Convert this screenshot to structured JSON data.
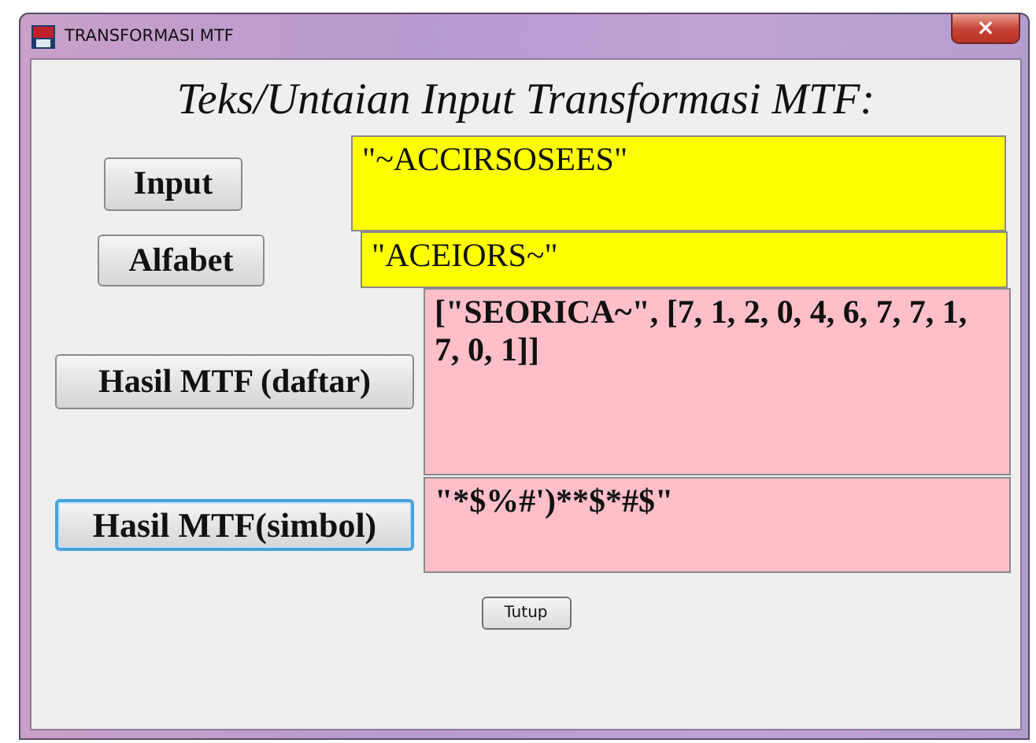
{
  "window": {
    "title": "TRANSFORMASI MTF",
    "close": "×"
  },
  "heading": "Teks/Untaian Input Transformasi MTF:",
  "rows": [
    {
      "button": {
        "label": "Input",
        "focused": false
      },
      "field": {
        "kind": "input",
        "value": "\"~ACCIRSOSEES\""
      }
    },
    {
      "button": {
        "label": "Alfabet",
        "focused": false
      },
      "field": {
        "kind": "input",
        "value": "\"ACEIORS~\""
      }
    },
    {
      "button": {
        "label": "Hasil MTF (daftar)",
        "focused": false
      },
      "field": {
        "kind": "output",
        "value": "[\"SEORICA~\", [7, 1, 2, 0, 4, 6, 7, 7, 1, 7, 0, 1]]"
      }
    },
    {
      "button": {
        "label": "Hasil MTF(simbol)",
        "focused": true
      },
      "field": {
        "kind": "output",
        "value": "\"*$%#')**$*#$\""
      }
    }
  ],
  "close_button": "Tutup"
}
